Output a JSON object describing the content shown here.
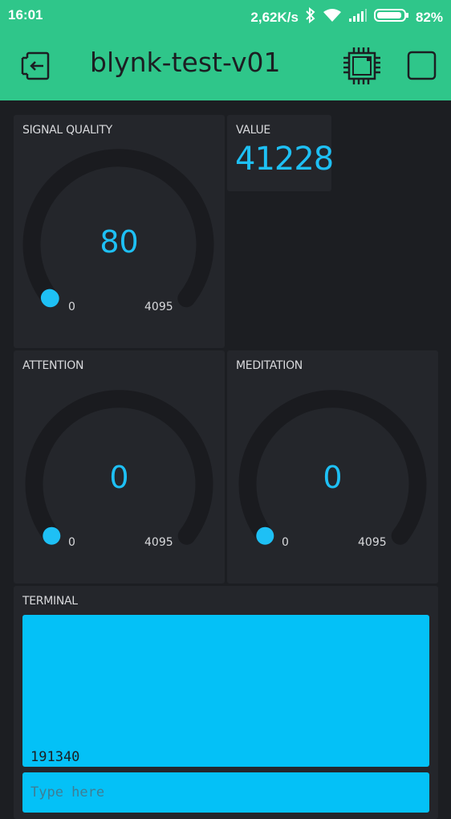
{
  "status_bar": {
    "time": "16:01",
    "network_speed": "2,62K/s",
    "battery_percent": "82%",
    "icons": [
      "bluetooth-icon",
      "wifi-icon",
      "signal-icon",
      "battery-icon"
    ]
  },
  "app_bar": {
    "title": "blynk-test-v01",
    "icons": [
      "exit-icon",
      "chip-icon",
      "stop-icon"
    ],
    "background_color": "#2fc68a"
  },
  "widgets": {
    "signal_quality": {
      "label": "SIGNAL QUALITY",
      "value": "80",
      "min": "0",
      "max": "4095"
    },
    "value_display": {
      "label": "VALUE",
      "value": "41228"
    },
    "attention": {
      "label": "ATTENTION",
      "value": "0",
      "min": "0",
      "max": "4095"
    },
    "meditation": {
      "label": "MEDITATION",
      "value": "0",
      "min": "0",
      "max": "4095"
    },
    "terminal": {
      "label": "TERMINAL",
      "output_line": "191340",
      "input_placeholder": "Type here"
    }
  },
  "colors": {
    "accent": "#1ec0f5",
    "widget_bg": "#24262b",
    "page_bg": "#1c1e22",
    "gauge_track": "#1a1b1f",
    "terminal_bg": "#04c1f7"
  }
}
